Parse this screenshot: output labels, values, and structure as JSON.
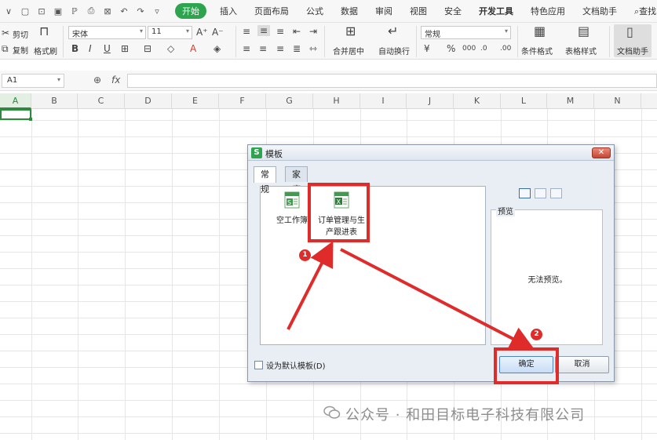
{
  "menubar": {
    "items": [
      "开始",
      "插入",
      "页面布局",
      "公式",
      "数据",
      "审阅",
      "视图",
      "安全",
      "开发工具",
      "特色应用",
      "文档助手",
      "查找"
    ],
    "active": "开始"
  },
  "ribbon": {
    "cut": "剪切",
    "copy": "复制",
    "format_painter": "格式刷",
    "font_name": "宋体",
    "font_size": "11",
    "merge_center": "合并居中",
    "wrap_text": "自动换行",
    "number_format": "常规",
    "conditional_format": "条件格式",
    "table_style": "表格样式",
    "doc_helper": "文档助手"
  },
  "formula_bar": {
    "name_box": "A1",
    "fx": "fx",
    "formula": ""
  },
  "columns": [
    "A",
    "B",
    "C",
    "D",
    "E",
    "F",
    "G",
    "H",
    "I",
    "J",
    "K",
    "L",
    "M",
    "N"
  ],
  "dialog": {
    "title": "模板",
    "close": "✕",
    "tabs": [
      "常规",
      "家庭生活"
    ],
    "templates": [
      {
        "name": "空工作簿"
      },
      {
        "name_line1": "订单管理与生",
        "name_line2": "产跟进表"
      }
    ],
    "preview_label": "预览",
    "no_preview": "无法预览。",
    "set_default": "设为默认模板(D)",
    "ok": "确定",
    "cancel": "取消"
  },
  "annotations": {
    "badge1": "1",
    "badge2": "2",
    "color": "#e02b2b"
  },
  "watermark": "公众号 · 和田目标电子科技有限公司",
  "colors": {
    "accent": "#2ea44f",
    "highlight": "#e02b2b",
    "dialog_bg": "#e9eef5"
  }
}
